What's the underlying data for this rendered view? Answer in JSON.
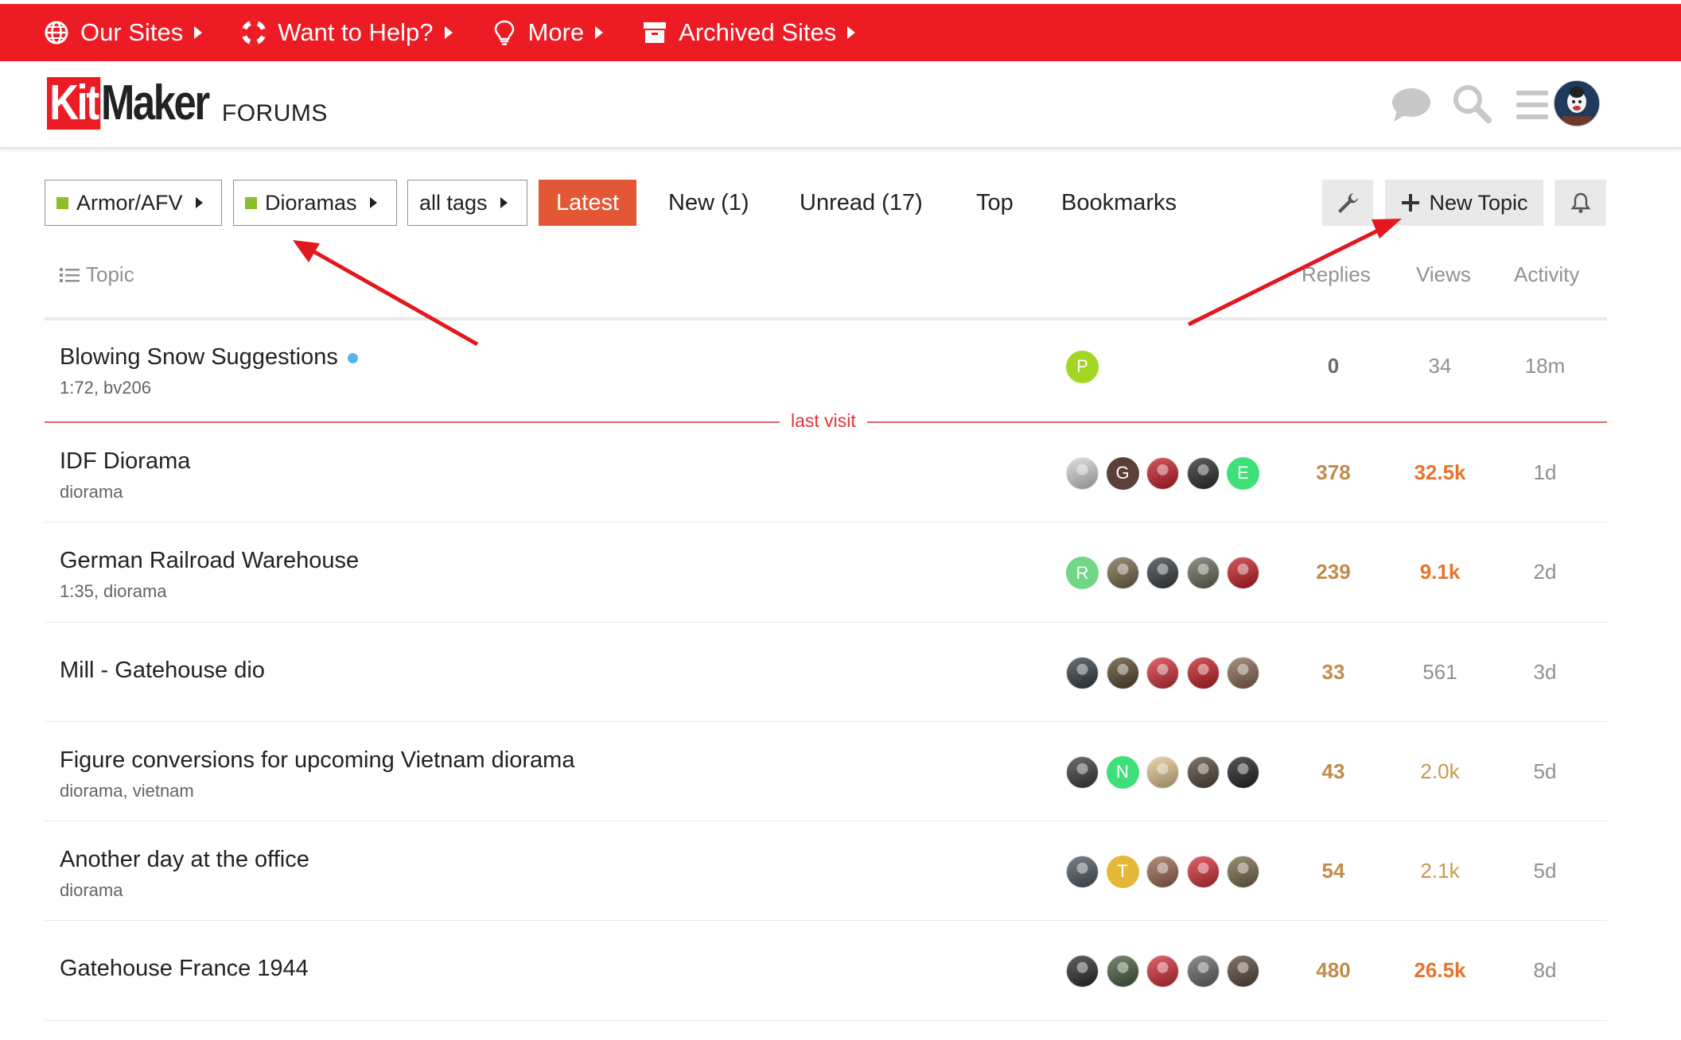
{
  "topbar": {
    "bg_color": "#ed1c24",
    "items": [
      {
        "label": "Our Sites",
        "icon": "globe-icon"
      },
      {
        "label": "Want to Help?",
        "icon": "lifebuoy-icon"
      },
      {
        "label": "More",
        "icon": "lightbulb-icon"
      },
      {
        "label": "Archived Sites",
        "icon": "archive-icon"
      }
    ]
  },
  "header": {
    "logo": {
      "kit": "Kit",
      "maker": "Maker",
      "forums": "FORUMS"
    },
    "icons": [
      "chat-icon",
      "search-icon",
      "hamburger-menu-icon",
      "user-avatar"
    ]
  },
  "nav": {
    "category": "Armor/AFV",
    "subcategory": "Dioramas",
    "tags": "all tags",
    "links": {
      "latest": "Latest",
      "new": "New (1)",
      "unread": "Unread (17)",
      "top": "Top",
      "bookmarks": "Bookmarks"
    },
    "new_topic": "New Topic",
    "category_color": "#8bbd2c",
    "active_color": "#e45735"
  },
  "table": {
    "headers": {
      "topic": "Topic",
      "replies": "Replies",
      "views": "Views",
      "activity": "Activity"
    },
    "last_visit": "last visit",
    "rows": [
      {
        "title": "Blowing Snow Suggestions",
        "tags": "1:72, bv206",
        "replies": "0",
        "views": "34",
        "activity": "18m",
        "avatars": [
          {
            "letter": "P",
            "color": "#a3d624"
          }
        ]
      },
      {
        "title": "IDF Diorama",
        "tags": "diorama",
        "replies": "378",
        "views": "32.5k",
        "activity": "1d",
        "avatars": [
          {
            "letter": "",
            "color": "#d5d5d5"
          },
          {
            "letter": "G",
            "color": "#5b4038"
          },
          {
            "letter": "",
            "color": "#c82027"
          },
          {
            "letter": "",
            "color": "#2c2c2c"
          },
          {
            "letter": "E",
            "color": "#3fe07a"
          }
        ]
      },
      {
        "title": "German Railroad Warehouse",
        "tags": "1:35, diorama",
        "replies": "239",
        "views": "9.1k",
        "activity": "2d",
        "avatars": [
          {
            "letter": "R",
            "color": "#6fd786"
          },
          {
            "letter": "",
            "color": "#7a6a4a"
          },
          {
            "letter": "",
            "color": "#3a4045"
          },
          {
            "letter": "",
            "color": "#6b6e5c"
          },
          {
            "letter": "",
            "color": "#c82027"
          }
        ]
      },
      {
        "title": "Mill - Gatehouse dio",
        "tags": "",
        "replies": "33",
        "views": "561",
        "activity": "3d",
        "avatars": [
          {
            "letter": "",
            "color": "#33404a"
          },
          {
            "letter": "",
            "color": "#5a4a2e"
          },
          {
            "letter": "",
            "color": "#d8303a"
          },
          {
            "letter": "",
            "color": "#c82027"
          },
          {
            "letter": "",
            "color": "#8b6a58"
          }
        ]
      },
      {
        "title": "Figure conversions for upcoming Vietnam diorama",
        "tags": "diorama, vietnam",
        "replies": "43",
        "views": "2.0k",
        "activity": "5d",
        "avatars": [
          {
            "letter": "",
            "color": "#3d3d3d"
          },
          {
            "letter": "N",
            "color": "#3fe07a"
          },
          {
            "letter": "",
            "color": "#e8c890"
          },
          {
            "letter": "",
            "color": "#55483c"
          },
          {
            "letter": "",
            "color": "#222"
          }
        ]
      },
      {
        "title": "Another day at the office",
        "tags": "diorama",
        "replies": "54",
        "views": "2.1k",
        "activity": "5d",
        "avatars": [
          {
            "letter": "",
            "color": "#4c5a66"
          },
          {
            "letter": "T",
            "color": "#e6b83a"
          },
          {
            "letter": "",
            "color": "#9b6a52"
          },
          {
            "letter": "",
            "color": "#d8303a"
          },
          {
            "letter": "",
            "color": "#7a6a4a"
          }
        ]
      },
      {
        "title": "Gatehouse France 1944",
        "tags": "",
        "replies": "480",
        "views": "26.5k",
        "activity": "8d",
        "avatars": [
          {
            "letter": "",
            "color": "#2c2c2c"
          },
          {
            "letter": "",
            "color": "#4a6040"
          },
          {
            "letter": "",
            "color": "#d8303a"
          },
          {
            "letter": "",
            "color": "#6a6a6a"
          },
          {
            "letter": "",
            "color": "#5a4a3a"
          }
        ]
      }
    ]
  },
  "annotation_color": "#e3171e"
}
